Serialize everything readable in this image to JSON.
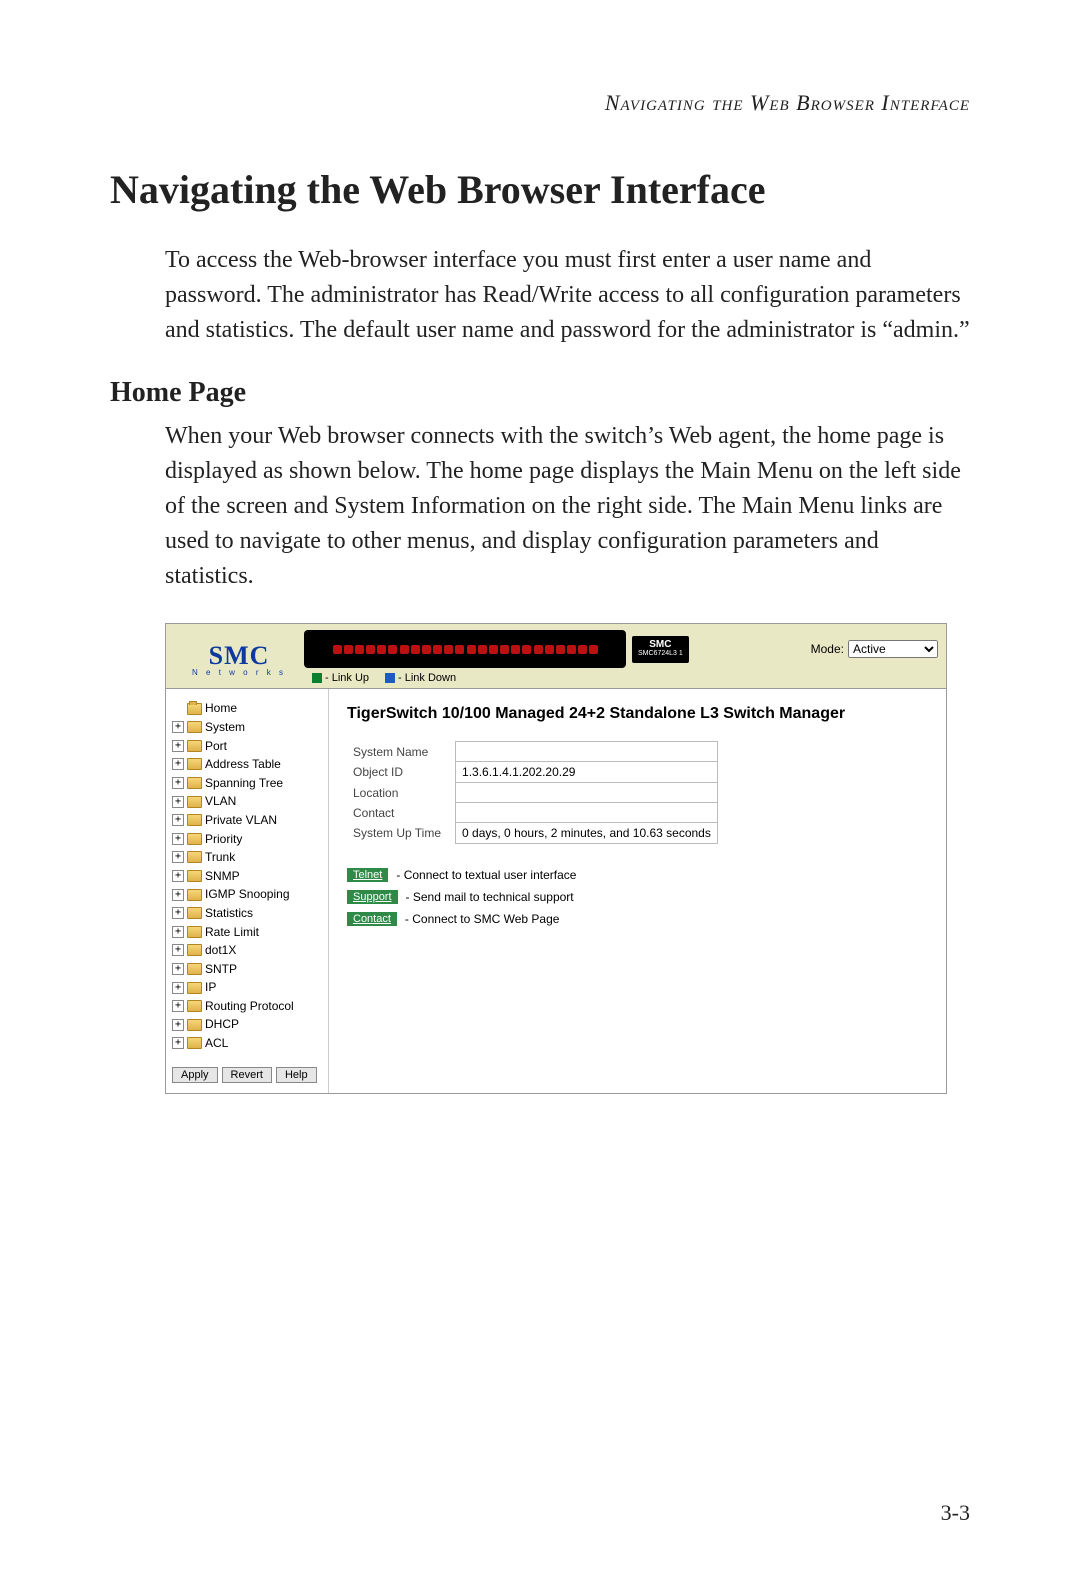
{
  "running_head": "Navigating the Web Browser Interface",
  "title": "Navigating the Web Browser Interface",
  "intro": "To access the Web-browser interface you must first enter a user name and password. The administrator has Read/Write access to all configuration parameters and statistics. The default user name and password for the administrator is “admin.”",
  "section_title": "Home Page",
  "section_body": "When your Web browser connects with the switch’s Web agent, the home page is displayed as shown below. The home page displays the Main Menu on the left side of the screen and System Information on the right side. The Main Menu links are used to navigate to other menus, and display configuration parameters and statistics.",
  "page_number": "3-3",
  "app": {
    "logo_text": "SMC",
    "logo_sub": "N e t w o r k s",
    "brand_badge": {
      "title": "SMC",
      "model": "SMC6724L3 1"
    },
    "mode_label": "Mode:",
    "mode_value": "Active",
    "legend": {
      "up": "- Link Up",
      "down": "- Link Down"
    },
    "nav": {
      "items": [
        {
          "label": "Home",
          "expandable": false,
          "open": true
        },
        {
          "label": "System"
        },
        {
          "label": "Port"
        },
        {
          "label": "Address Table"
        },
        {
          "label": "Spanning Tree"
        },
        {
          "label": "VLAN"
        },
        {
          "label": "Private VLAN"
        },
        {
          "label": "Priority"
        },
        {
          "label": "Trunk"
        },
        {
          "label": "SNMP"
        },
        {
          "label": "IGMP Snooping"
        },
        {
          "label": "Statistics"
        },
        {
          "label": "Rate Limit"
        },
        {
          "label": "dot1X"
        },
        {
          "label": "SNTP"
        },
        {
          "label": "IP"
        },
        {
          "label": "Routing Protocol"
        },
        {
          "label": "DHCP"
        },
        {
          "label": "ACL"
        }
      ],
      "buttons": {
        "apply": "Apply",
        "revert": "Revert",
        "help": "Help"
      }
    },
    "content": {
      "heading": "TigerSwitch 10/100 Managed 24+2 Standalone L3 Switch Manager",
      "rows": [
        {
          "label": "System Name",
          "value": ""
        },
        {
          "label": "Object ID",
          "value": "1.3.6.1.4.1.202.20.29"
        },
        {
          "label": "Location",
          "value": ""
        },
        {
          "label": "Contact",
          "value": ""
        },
        {
          "label": "System Up Time",
          "value": "0 days, 0 hours, 2 minutes, and 10.63 seconds"
        }
      ],
      "links": [
        {
          "button": "Telnet",
          "desc": "- Connect to textual user interface"
        },
        {
          "button": "Support",
          "desc": "- Send mail to technical support"
        },
        {
          "button": "Contact",
          "desc": "- Connect to SMC Web Page"
        }
      ]
    }
  }
}
